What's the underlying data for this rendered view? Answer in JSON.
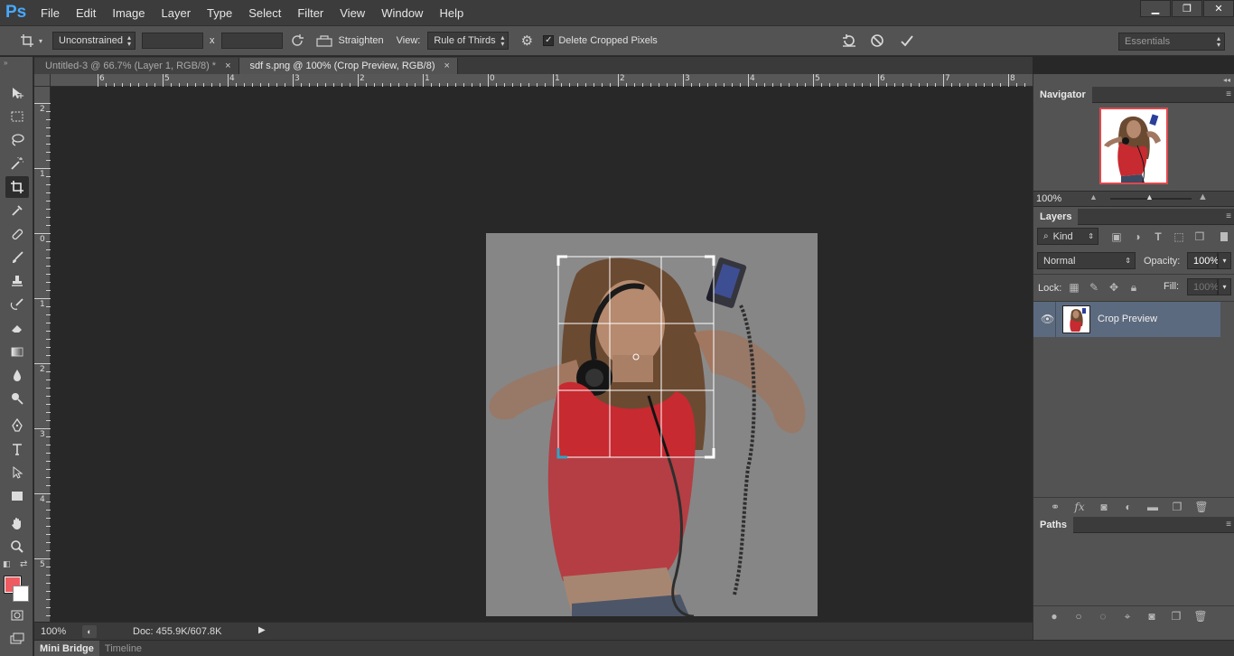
{
  "app": {
    "logo": "Ps"
  },
  "menu": [
    "File",
    "Edit",
    "Image",
    "Layer",
    "Type",
    "Select",
    "Filter",
    "View",
    "Window",
    "Help"
  ],
  "window_controls": {
    "minimize": "▁",
    "restore": "❐",
    "close": "✕"
  },
  "options": {
    "ratio_value": "Unconstrained",
    "width_value": "",
    "height_value": "",
    "x_separator": "x",
    "straighten_label": "Straighten",
    "view_label": "View:",
    "view_value": "Rule of Thirds",
    "delete_cropped_label": "Delete Cropped Pixels",
    "delete_cropped_checked": true,
    "workspace": "Essentials"
  },
  "tabs": [
    {
      "label": "Untitled-3 @ 66.7% (Layer 1, RGB/8) *",
      "close": "×",
      "active": false
    },
    {
      "label": "sdf s.png @ 100% (Crop Preview, RGB/8)",
      "close": "×",
      "active": true
    }
  ],
  "rulers": {
    "horizontal": [
      "6",
      "5",
      "4",
      "3",
      "2",
      "1",
      "0",
      "1",
      "2",
      "3",
      "4",
      "5",
      "6",
      "7",
      "8"
    ],
    "vertical": [
      "2",
      "1",
      "0",
      "1",
      "2",
      "3",
      "4",
      "5"
    ]
  },
  "colors": {
    "foreground": "#ef5b61",
    "background": "#ffffff",
    "canvas_gray": "#8a8a8a",
    "top": "#c72a30"
  },
  "status": {
    "zoom": "100%",
    "doc": "Doc: 455.9K/607.8K"
  },
  "bottom_tabs": [
    "Mini Bridge",
    "Timeline"
  ],
  "navigator": {
    "title": "Navigator",
    "zoom": "100%"
  },
  "layers": {
    "title": "Layers",
    "kind_label": "Kind",
    "blend_mode": "Normal",
    "opacity_label": "Opacity:",
    "opacity_value": "100%",
    "lock_label": "Lock:",
    "fill_label": "Fill:",
    "fill_value": "100%",
    "items": [
      {
        "name": "Crop Preview",
        "selected": true
      }
    ]
  },
  "paths": {
    "title": "Paths"
  }
}
